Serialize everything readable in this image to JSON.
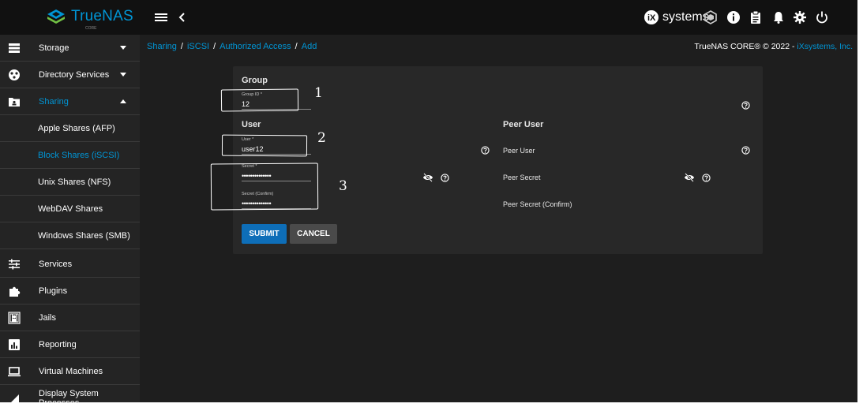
{
  "app": {
    "logo_text": "TrueNAS",
    "logo_sub": "CORE",
    "vendor_text": "systems"
  },
  "sidebar": {
    "items": [
      {
        "label": "Storage"
      },
      {
        "label": "Directory Services"
      },
      {
        "label": "Sharing"
      },
      {
        "label": "Services"
      },
      {
        "label": "Plugins"
      },
      {
        "label": "Jails"
      },
      {
        "label": "Reporting"
      },
      {
        "label": "Virtual Machines"
      },
      {
        "label": "Display System Processes"
      }
    ],
    "sharing_sub": [
      {
        "label": "Apple Shares (AFP)"
      },
      {
        "label": "Block Shares (iSCSI)"
      },
      {
        "label": "Unix Shares (NFS)"
      },
      {
        "label": "WebDAV Shares"
      },
      {
        "label": "Windows Shares (SMB)"
      }
    ]
  },
  "breadcrumb": {
    "items": [
      "Sharing",
      "iSCSI",
      "Authorized Access",
      "Add"
    ],
    "separator": "/"
  },
  "copyright": {
    "text": "TrueNAS CORE® © 2022 - ",
    "link": "iXsystems, Inc."
  },
  "form": {
    "group_title": "Group",
    "group_id": {
      "label": "Group ID *",
      "value": "12"
    },
    "user_title": "User",
    "user": {
      "label": "User *",
      "value": "user12"
    },
    "secret": {
      "label": "Secret *",
      "value": "••••••••••••••"
    },
    "secret_confirm": {
      "label": "Secret (Confirm)",
      "value": "••••••••••••••"
    },
    "peer_title": "Peer User",
    "peer_user_label": "Peer User",
    "peer_secret_label": "Peer Secret",
    "peer_secret_confirm_label": "Peer Secret (Confirm)",
    "submit_label": "SUBMIT",
    "cancel_label": "CANCEL"
  },
  "annotations": {
    "one": "1",
    "two": "2",
    "three": "3"
  },
  "colors": {
    "accent": "#0095d5",
    "submit": "#0e6eb8",
    "background": "#1e1e1e",
    "topbar": "#111111",
    "card": "#282828"
  }
}
